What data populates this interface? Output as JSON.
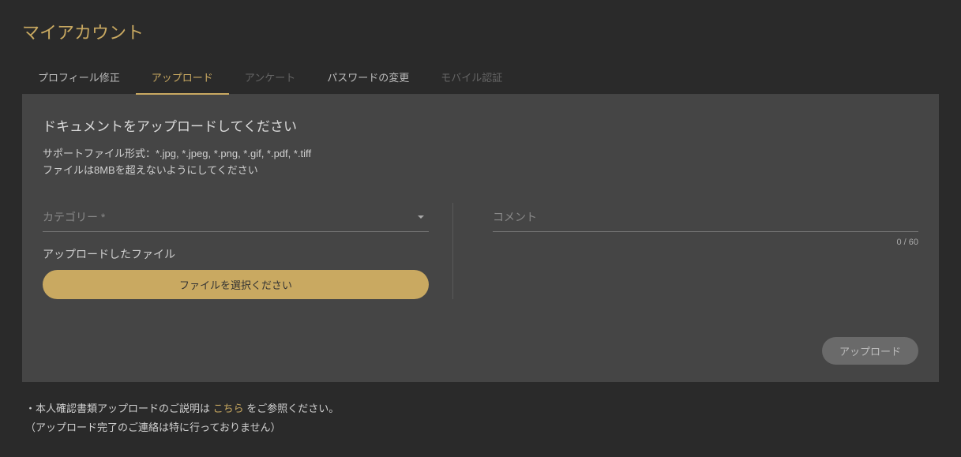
{
  "page_title": "マイアカウント",
  "tabs": {
    "profile": "プロフィール修正",
    "upload": "アップロード",
    "survey": "アンケート",
    "password": "パスワードの変更",
    "mobile": "モバイル認証"
  },
  "panel": {
    "title": "ドキュメントをアップロードしてください",
    "supported_formats": "サポートファイル形式：*.jpg, *.jpeg, *.png, *.gif, *.pdf, *.tiff",
    "size_limit": "ファイルは8MBを超えないようにしてください"
  },
  "form": {
    "category_label": "カテゴリー *",
    "uploaded_label": "アップロードしたファイル",
    "file_button": "ファイルを選択ください",
    "comment_label": "コメント",
    "char_count": "0 / 60",
    "upload_button": "アップロード"
  },
  "footer": {
    "note1_prefix": "・本人確認書類アップロードのご説明は ",
    "note1_link": "こちら",
    "note1_suffix": " をご参照ください。",
    "note2": "（アップロード完了のご連絡は特に行っておりません）"
  }
}
